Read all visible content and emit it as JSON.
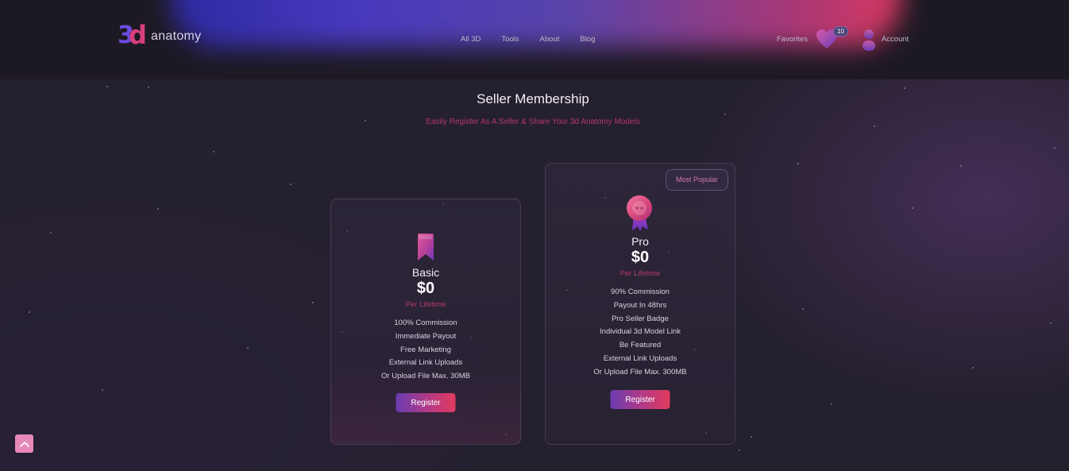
{
  "brand": {
    "logo_text": "anatomy",
    "logo_mark": "3d"
  },
  "nav": {
    "items": [
      "All 3D",
      "Tools",
      "About",
      "Blog"
    ]
  },
  "header": {
    "favorites_label": "Favorites",
    "favorites_count": "10",
    "account_label": "Account"
  },
  "page": {
    "title": "Seller Membership",
    "subtitle": "Easily Register As A Seller & Share Your 3d Anatomy Models"
  },
  "plans": [
    {
      "name": "Basic",
      "price": "$0",
      "period": "Per Lifetime",
      "icon": "bookmark-icon",
      "features": [
        "100% Commission",
        "Immediate Payout",
        "Free Marketing",
        "External Link Uploads",
        "Or Upload File Max. 30MB"
      ],
      "button_label": "Register"
    },
    {
      "name": "Pro",
      "price": "$0",
      "period": "Per Lifetime",
      "icon": "award-ribbon-icon",
      "badge": "Most Popular",
      "features": [
        "90% Commission",
        "Payout In 48hrs",
        "Pro Seller Badge",
        "Individual 3d Model Link",
        "Be Featured",
        "External Link Uploads",
        "Or Upload File Max. 300MB"
      ],
      "button_label": "Register"
    }
  ],
  "colors": {
    "accent_pink": "#b53a70",
    "button_gradient_start": "#6a3db0",
    "button_gradient_end": "#e23b5e",
    "background": "#25202e",
    "header_bg": "#1d1923"
  },
  "scroll_top": {
    "icon": "chevron-up-icon"
  }
}
